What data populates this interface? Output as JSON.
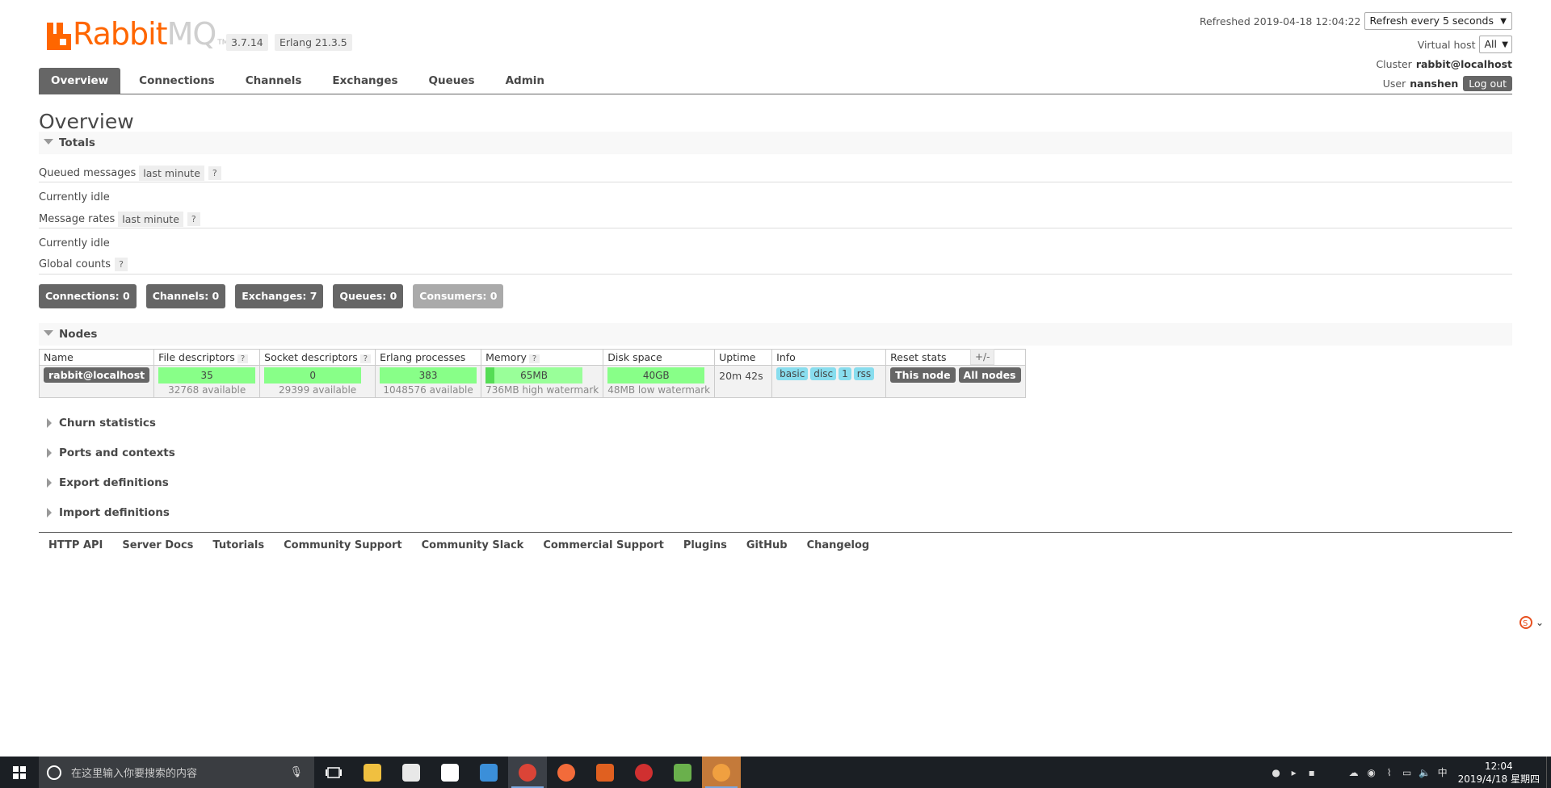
{
  "app": {
    "logo_rabbit": "Rabbit",
    "logo_mq": "MQ",
    "logo_tm": "TM",
    "version": "3.7.14",
    "erlang": "Erlang 21.3.5"
  },
  "header": {
    "refreshed_label": "Refreshed 2019-04-18 12:04:22",
    "refresh_select": "Refresh every 5 seconds",
    "vhost_label": "Virtual host",
    "vhost_value": "All",
    "cluster_label": "Cluster",
    "cluster_value": "rabbit@localhost",
    "user_label": "User",
    "user_value": "nanshen",
    "logout": "Log out"
  },
  "nav": {
    "tabs": [
      {
        "label": "Overview",
        "active": true
      },
      {
        "label": "Connections"
      },
      {
        "label": "Channels"
      },
      {
        "label": "Exchanges"
      },
      {
        "label": "Queues"
      },
      {
        "label": "Admin"
      }
    ]
  },
  "page": {
    "title": "Overview",
    "totals": {
      "heading": "Totals",
      "queued_messages": "Queued messages",
      "queued_period": "last minute",
      "help": "?",
      "idle1": "Currently idle",
      "message_rates": "Message rates",
      "rates_period": "last minute",
      "idle2": "Currently idle",
      "global_counts": "Global counts"
    },
    "counts": {
      "connections": "Connections: 0",
      "channels": "Channels: 0",
      "exchanges": "Exchanges: 7",
      "queues": "Queues: 0",
      "consumers": "Consumers: 0"
    },
    "nodes": {
      "heading": "Nodes",
      "columns": [
        "Name",
        "File descriptors",
        "Socket descriptors",
        "Erlang processes",
        "Memory",
        "Disk space",
        "Uptime",
        "Info",
        "Reset stats"
      ],
      "plusminus": "+/-",
      "row": {
        "name": "rabbit@localhost",
        "fd": "35",
        "fd_avail": "32768 available",
        "sd": "0",
        "sd_avail": "29399 available",
        "erl": "383",
        "erl_avail": "1048576 available",
        "memory": "65MB",
        "memory_fraction": 0.09,
        "memory_sub": "736MB high watermark",
        "disk": "40GB",
        "disk_sub": "48MB low watermark",
        "uptime": "20m 42s",
        "info_tags": [
          "basic",
          "disc",
          "1",
          "rss"
        ],
        "reset_this": "This node",
        "reset_all": "All nodes"
      }
    },
    "collapsed_sections": [
      "Churn statistics",
      "Ports and contexts",
      "Export definitions",
      "Import definitions"
    ]
  },
  "footer": {
    "links": [
      "HTTP API",
      "Server Docs",
      "Tutorials",
      "Community Support",
      "Community Slack",
      "Commercial Support",
      "Plugins",
      "GitHub",
      "Changelog"
    ]
  },
  "taskbar": {
    "search_placeholder": "在这里输入你要搜索的内容",
    "time": "12:04",
    "date": "2019/4/18 星期四",
    "apps": [
      {
        "icon": "file-explorer-icon",
        "color": "#f0c040"
      },
      {
        "icon": "store-icon",
        "color": "#e8e8e8"
      },
      {
        "icon": "mail-icon",
        "color": "#ffffff"
      },
      {
        "icon": "app-blue-icon",
        "color": "#3b8fd9"
      },
      {
        "icon": "chrome-icon",
        "color": "#db4437"
      },
      {
        "icon": "postman-icon",
        "color": "#f26b3a"
      },
      {
        "icon": "powerpoint-icon",
        "color": "#e06020"
      },
      {
        "icon": "snail-icon",
        "color": "#d03030"
      },
      {
        "icon": "tool-green-icon",
        "color": "#6ab04c"
      },
      {
        "icon": "search-app-icon",
        "color": "#f0a040"
      }
    ]
  }
}
